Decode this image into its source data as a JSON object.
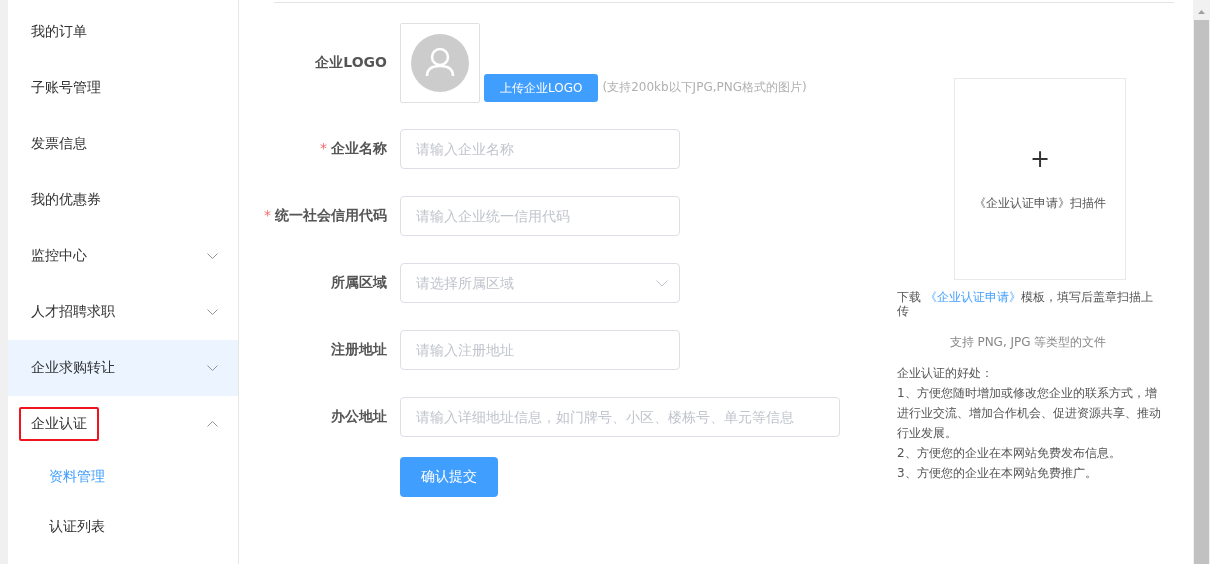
{
  "sidebar": {
    "items": [
      {
        "label": "我的订单",
        "kind": "link",
        "hovered": false,
        "marked": false
      },
      {
        "label": "子账号管理",
        "kind": "link",
        "hovered": false,
        "marked": false
      },
      {
        "label": "发票信息",
        "kind": "link",
        "hovered": false,
        "marked": false
      },
      {
        "label": "我的优惠券",
        "kind": "link",
        "hovered": false,
        "marked": false
      },
      {
        "label": "监控中心",
        "kind": "group",
        "expanded": false,
        "hovered": false,
        "marked": false
      },
      {
        "label": "人才招聘求职",
        "kind": "group",
        "expanded": false,
        "hovered": false,
        "marked": false
      },
      {
        "label": "企业求购转让",
        "kind": "group",
        "expanded": false,
        "hovered": true,
        "marked": false
      },
      {
        "label": "企业认证",
        "kind": "group",
        "expanded": true,
        "hovered": false,
        "marked": true,
        "children": [
          {
            "label": "资料管理",
            "selected": true
          },
          {
            "label": "认证列表",
            "selected": false
          }
        ]
      }
    ]
  },
  "form": {
    "fields": [
      {
        "label": "企业LOGO",
        "kind": "logo",
        "required": false,
        "button": "上传企业LOGO",
        "hint": "(支持200kb以下JPG,PNG格式的图片)"
      },
      {
        "label": "企业名称",
        "kind": "input",
        "required": true,
        "placeholder": "请输入企业名称"
      },
      {
        "label": "统一社会信用代码",
        "kind": "input",
        "required": true,
        "placeholder": "请输入企业统一信用代码"
      },
      {
        "label": "所属区域",
        "kind": "select",
        "required": false,
        "placeholder": "请选择所属区域"
      },
      {
        "label": "注册地址",
        "kind": "input",
        "required": false,
        "placeholder": "请输入注册地址"
      },
      {
        "label": "办公地址",
        "kind": "wide",
        "required": false,
        "placeholder": "请输入详细地址信息，如门牌号、小区、楼栋号、单元等信息"
      }
    ],
    "required_mark": "*",
    "submit": "确认提交"
  },
  "upload": {
    "plus": "+",
    "caption": "《企业认证申请》扫描件",
    "download_prefix": "下载 ",
    "download_link": "《企业认证申请》",
    "download_suffix": "模板，填写后盖章扫描上传",
    "formats": "支持 PNG, JPG 等类型的文件",
    "benefits_title": "企业认证的好处：",
    "benefits": [
      "1、方便您随时增加或修改您企业的联系方式，增进行业交流、增加合作机会、促进资源共享、推动行业发展。",
      "2、方便您的企业在本网站免费发布信息。",
      "3、方便您的企业在本网站免费推广。"
    ]
  }
}
